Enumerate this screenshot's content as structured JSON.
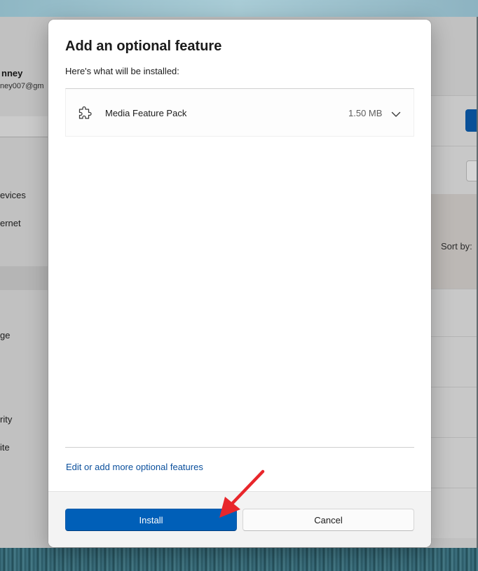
{
  "background": {
    "user_name": "nney",
    "user_email": "ney007@gm",
    "nav_items": [
      "evices",
      "ernet",
      "ge",
      "rity",
      "ite"
    ],
    "sort_label": "Sort by:"
  },
  "dialog": {
    "title": "Add an optional feature",
    "subtitle": "Here's what will be installed:",
    "features": [
      {
        "name": "Media Feature Pack",
        "size": "1.50 MB",
        "icon": "puzzle-icon"
      }
    ],
    "more_link": "Edit or add more optional features",
    "install_label": "Install",
    "cancel_label": "Cancel"
  },
  "colors": {
    "accent": "#005fb8",
    "link": "#0a4f9c",
    "annotation": "#e8262b"
  }
}
